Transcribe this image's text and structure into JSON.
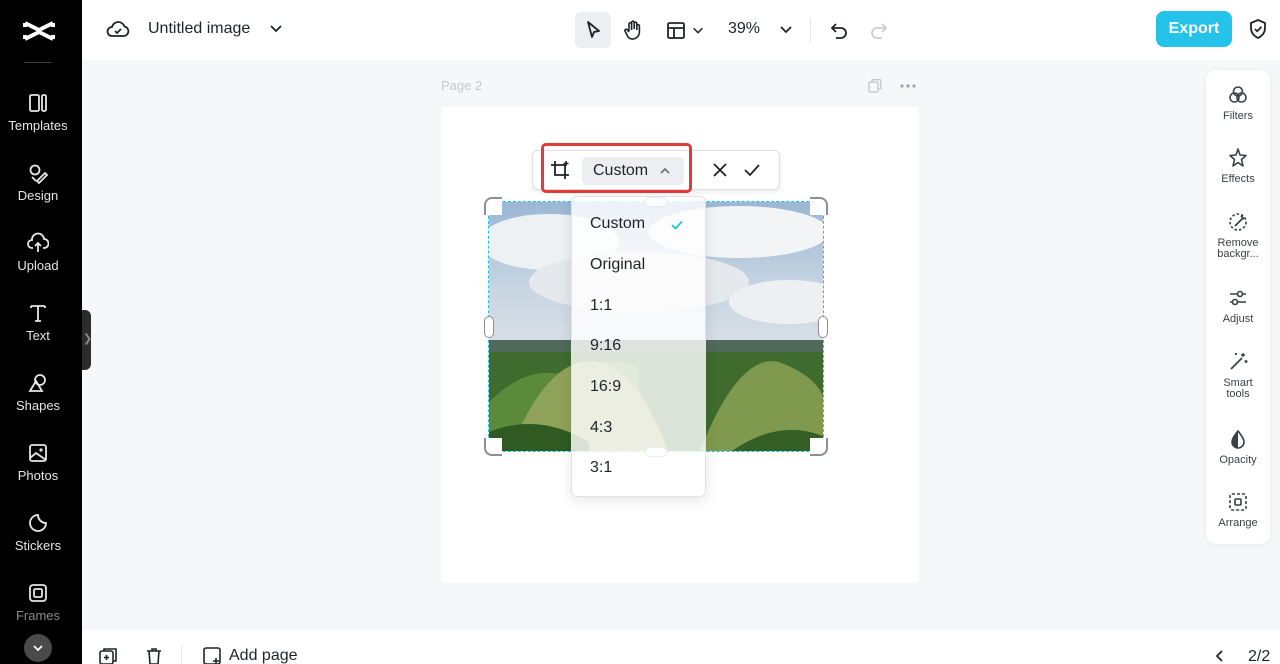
{
  "topbar": {
    "doc_title": "Untitled image",
    "zoom": "39%",
    "export_label": "Export"
  },
  "sidebar": {
    "items": [
      {
        "label": "Templates",
        "icon": "templates-icon"
      },
      {
        "label": "Design",
        "icon": "design-icon"
      },
      {
        "label": "Upload",
        "icon": "upload-icon"
      },
      {
        "label": "Text",
        "icon": "text-icon"
      },
      {
        "label": "Shapes",
        "icon": "shapes-icon"
      },
      {
        "label": "Photos",
        "icon": "photos-icon"
      },
      {
        "label": "Stickers",
        "icon": "stickers-icon"
      },
      {
        "label": "Frames",
        "icon": "frames-icon"
      }
    ]
  },
  "canvas": {
    "page_label": "Page 2"
  },
  "crop_toolbar": {
    "selected_ratio": "Custom"
  },
  "ratio_menu": {
    "options": [
      "Custom",
      "Original",
      "1:1",
      "9:16",
      "16:9",
      "4:3",
      "3:1"
    ],
    "selected": "Custom"
  },
  "right_panel": {
    "tools": [
      {
        "label": "Filters",
        "icon": "filters-icon"
      },
      {
        "label": "Effects",
        "icon": "effects-icon"
      },
      {
        "label": "Remove backgr...",
        "icon": "remove-background-icon"
      },
      {
        "label": "Adjust",
        "icon": "adjust-icon"
      },
      {
        "label": "Smart tools",
        "icon": "smart-tools-icon"
      },
      {
        "label": "Opacity",
        "icon": "opacity-icon"
      },
      {
        "label": "Arrange",
        "icon": "arrange-icon"
      }
    ]
  },
  "bottombar": {
    "add_page_label": "Add page",
    "page_count": "2/2"
  },
  "colors": {
    "accent": "#25c2ea",
    "selection": "#19c3e6",
    "highlight": "#e23a3a",
    "sidebar_bg": "#000000"
  }
}
